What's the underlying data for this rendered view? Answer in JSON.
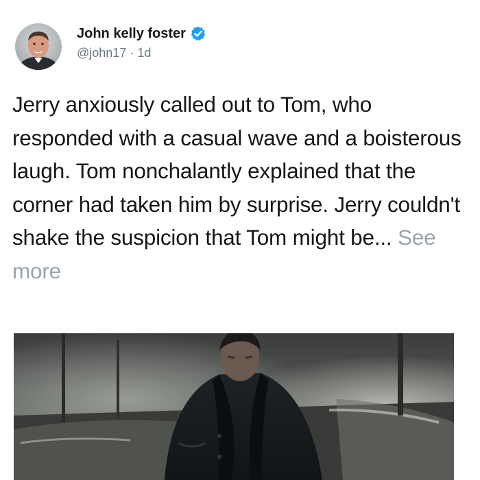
{
  "author": {
    "name": "John kelly foster",
    "handle": "@john17",
    "separator": " · ",
    "timestamp": "1d",
    "verified_icon": "verified-badge-icon",
    "avatar_icon": "profile-photo"
  },
  "post": {
    "text": "Jerry anxiously called out to Tom, who responded with a casual wave and a boisterous laugh. Tom nonchalantly explained that the corner had taken him by surprise. Jerry couldn't shake the suspicion that Tom might be...",
    "see_more_label": "See more"
  },
  "media": {
    "description_icon": "photo-man-in-dark-coat-street"
  },
  "colors": {
    "verified": "#1da1f2",
    "secondary_text": "#657786",
    "primary_text": "#14171a",
    "see_more": "#9aa4ad"
  }
}
